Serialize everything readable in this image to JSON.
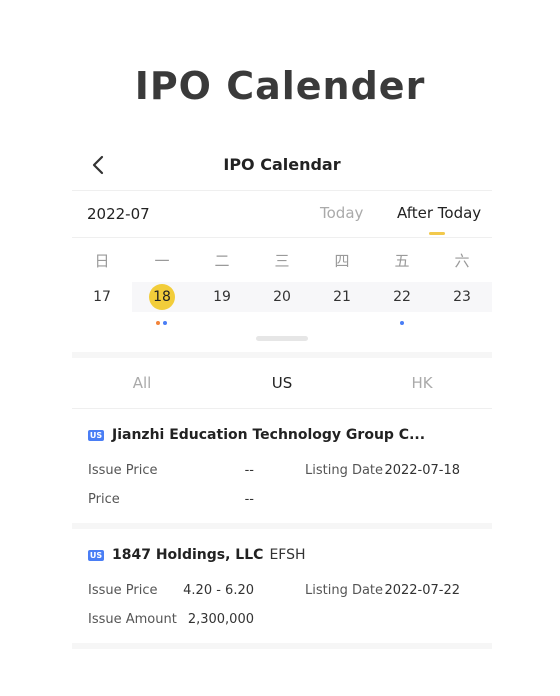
{
  "hero_title": "IPO Calender",
  "nav": {
    "title": "IPO Calendar",
    "back_icon": "chevron-left-icon"
  },
  "calendar": {
    "month": "2022-07",
    "tab_today": "Today",
    "tab_after_today": "After Today",
    "weekdays": [
      "日",
      "一",
      "二",
      "三",
      "四",
      "五",
      "六"
    ],
    "dates": [
      "17",
      "18",
      "19",
      "20",
      "21",
      "22",
      "23"
    ],
    "selected_date": "18",
    "accent_color": "#f2cd3a"
  },
  "filters": [
    "All",
    "US",
    "HK"
  ],
  "active_filter": "US",
  "ipos": [
    {
      "badge": "US",
      "name": "Jianzhi Education Technology Group C...",
      "ticker": "",
      "label1": "Issue Price",
      "value1": "--",
      "label2": "Listing Date",
      "value2": "2022-07-18",
      "label3": "Price",
      "value3": "--"
    },
    {
      "badge": "US",
      "name": "1847 Holdings, LLC",
      "ticker": "EFSH",
      "label1": "Issue Price",
      "value1": "4.20 - 6.20",
      "label2": "Listing Date",
      "value2": "2022-07-22",
      "label3": "Issue Amount",
      "value3": "2,300,000"
    }
  ]
}
